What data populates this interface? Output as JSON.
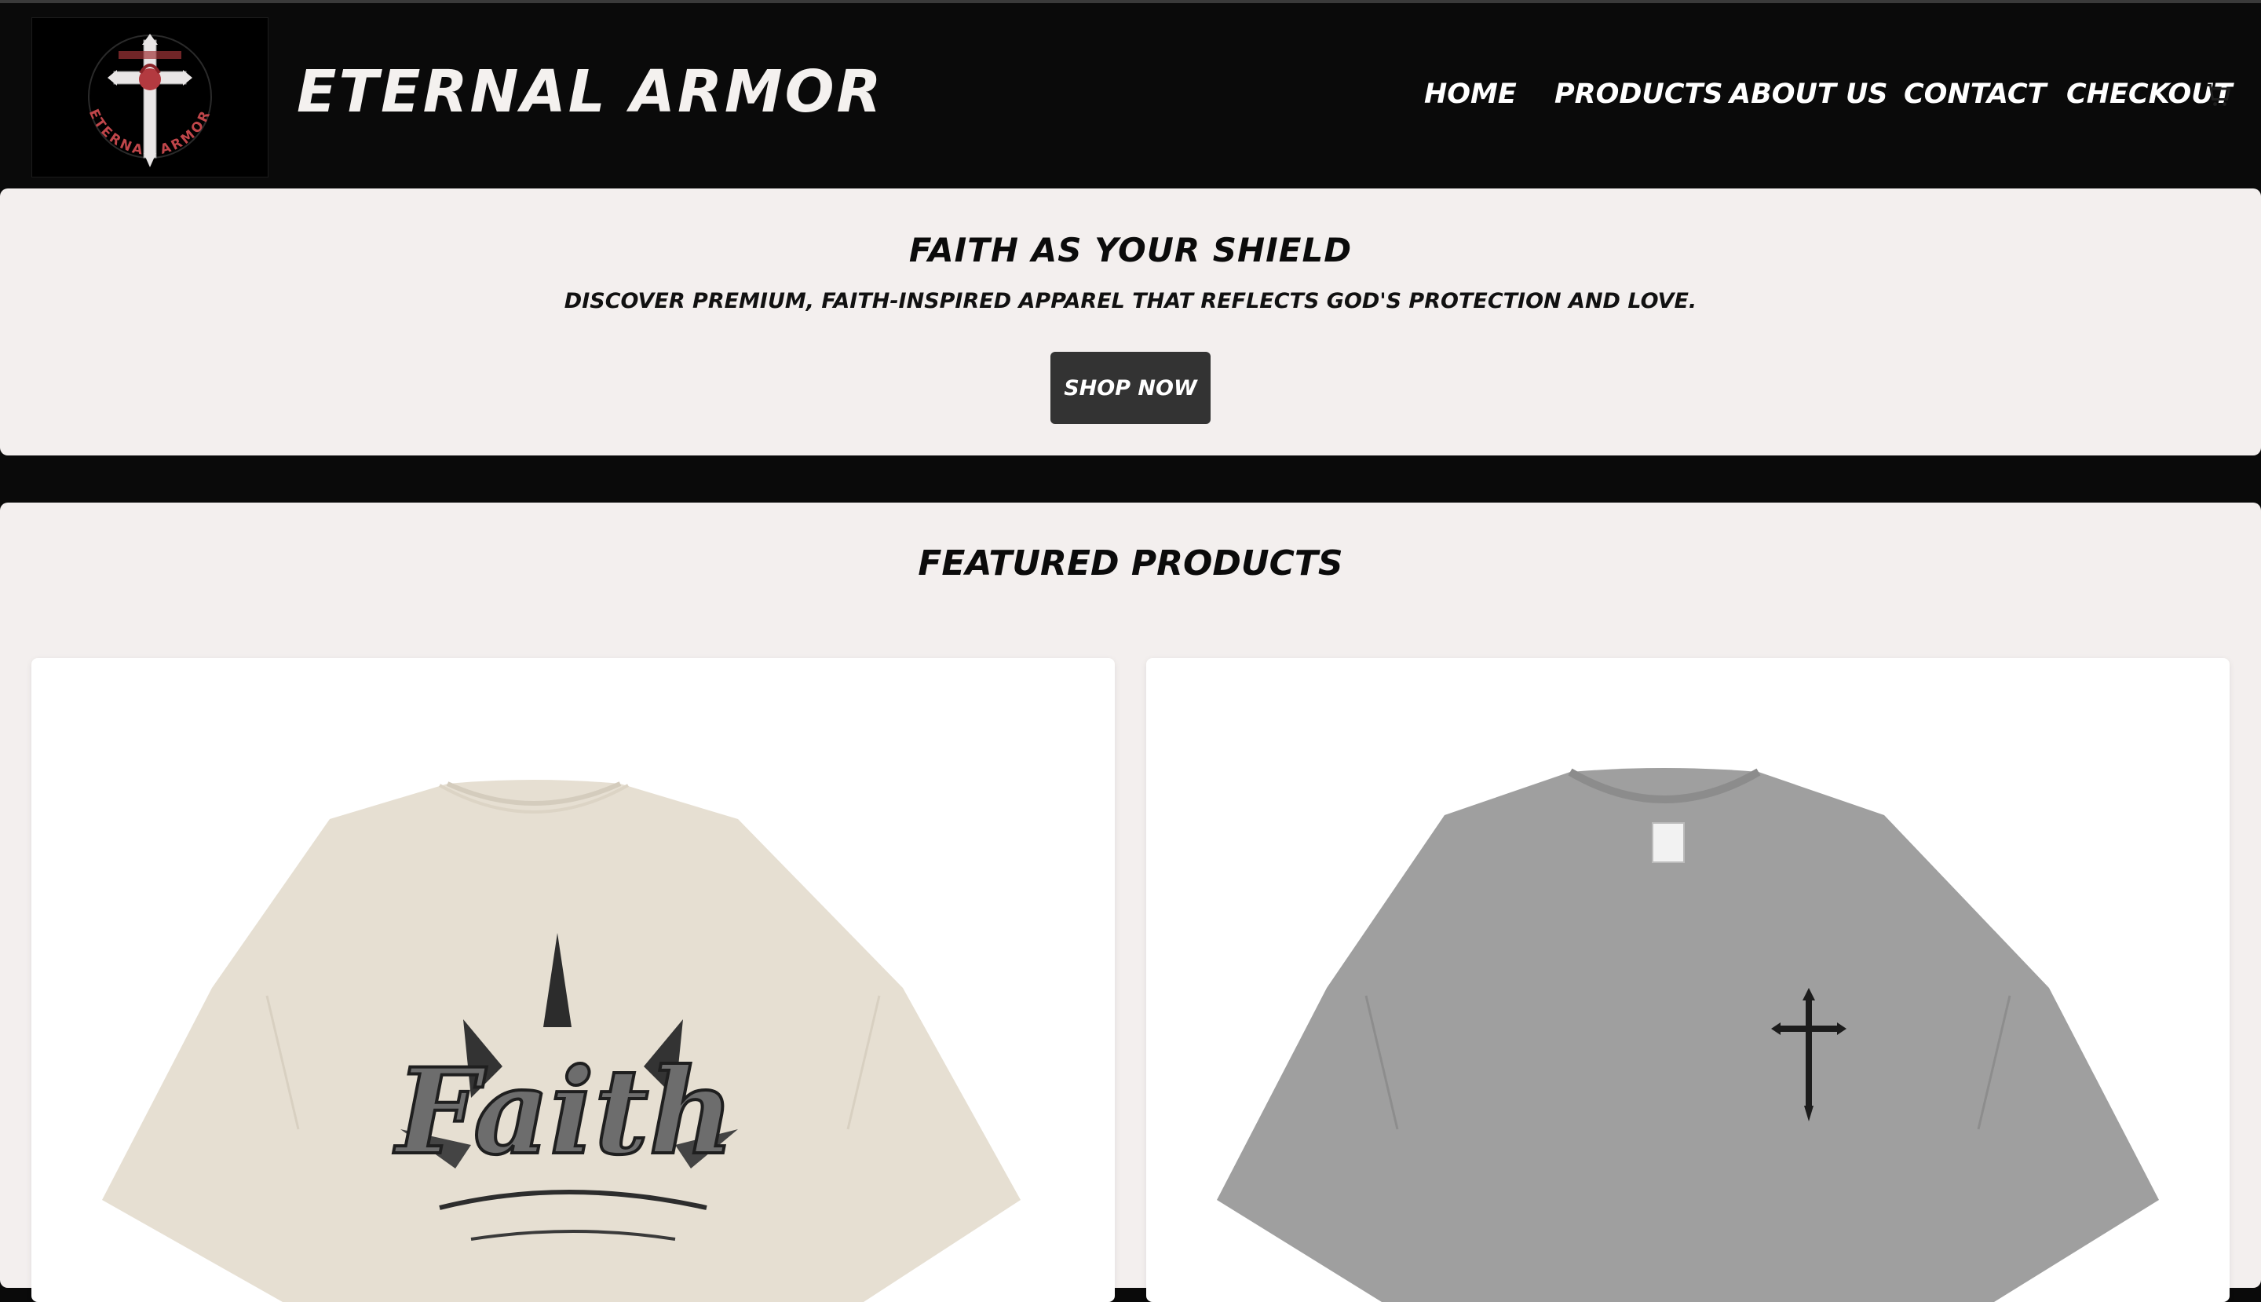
{
  "header": {
    "brand": "ETERNAL ARMOR",
    "logo": {
      "icon": "cross-crest-logo-icon",
      "ring_text": "ETERNAL ARMOR"
    },
    "nav": [
      {
        "label": "HOME"
      },
      {
        "label": "PRODUCTS"
      },
      {
        "label": "ABOUT US"
      },
      {
        "label": "CONTACT"
      },
      {
        "label": "CHECKOUT"
      }
    ],
    "cart_icon": "cart-icon"
  },
  "hero": {
    "title": "FAITH AS YOUR SHIELD",
    "subtitle": "DISCOVER PREMIUM, FAITH-INSPIRED APPAREL THAT REFLECTS GOD'S PROTECTION AND LOVE.",
    "button": "SHOP NOW"
  },
  "featured": {
    "title": "FEATURED PRODUCTS",
    "products": [
      {
        "image": "cream-tshirt-faith-graphic",
        "color": "#e6dfd2",
        "print_text": "Faith"
      },
      {
        "image": "grey-washed-tshirt-cross",
        "color": "#9f9f9f"
      }
    ]
  },
  "colors": {
    "background": "#0a0a0a",
    "panel": "#f3efee",
    "button": "#333333",
    "logo_accent": "#c0464a"
  }
}
